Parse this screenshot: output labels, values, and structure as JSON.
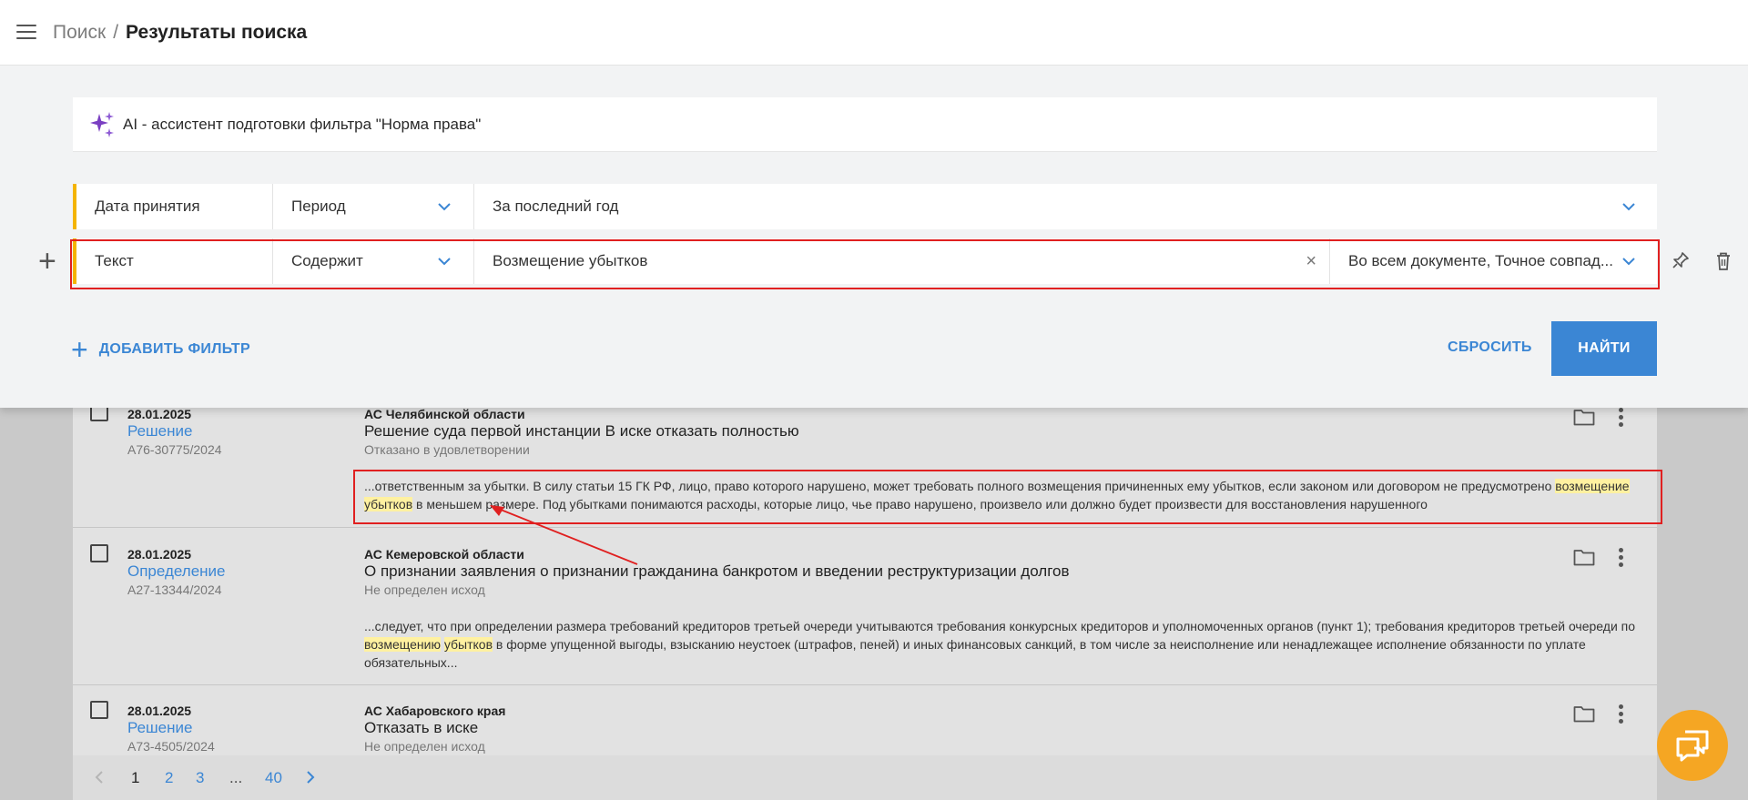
{
  "breadcrumb": {
    "link": "Поиск",
    "separator": "/",
    "current": "Результаты поиска"
  },
  "ai_assistant": {
    "label": "AI - ассистент подготовки фильтра \"Норма права\""
  },
  "filters": [
    {
      "field": "Дата принятия",
      "operator": "Период",
      "value": "За последний год"
    },
    {
      "field": "Текст",
      "operator": "Содержит",
      "value": "Возмещение убытков",
      "scope": "Во всем документе, Точное совпад..."
    }
  ],
  "actions": {
    "add_filter": "ДОБАВИТЬ ФИЛЬТР",
    "reset": "СБРОСИТЬ",
    "find": "НАЙТИ"
  },
  "results": [
    {
      "date": "28.01.2025",
      "doc_type": "Решение",
      "case": "А76-30775/2024",
      "court": "АС Челябинской области",
      "title": "Решение суда первой инстанции В иске отказать полностью",
      "outcome": "Отказано в удовлетворении",
      "snippet_a": "...ответственным за убытки. В силу статьи 15 ГК РФ, лицо, право которого нарушено, может требовать полного возмещения причиненных ему убытков, если законом или договором не предусмотрено",
      "snippet_hl1": "возмещение",
      "snippet_hl2": "убытков",
      "snippet_b": "в меньшем размере. Под убытками понимаются расходы, которые лицо, чье право нарушено, произвело или должно будет произвести для восстановления нарушенного"
    },
    {
      "date": "28.01.2025",
      "doc_type": "Определение",
      "case": "А27-13344/2024",
      "court": "АС Кемеровской области",
      "title": "О признании заявления о признании гражданина банкротом и введении реструктуризации долгов",
      "outcome": "Не определен исход",
      "snippet_a": "...следует, что при определении размера требований кредиторов третьей очереди учитываются требования конкурсных кредиторов и уполномоченных органов (пункт 1); требования кредиторов третьей очереди по",
      "snippet_hl1": "возмещению",
      "snippet_hl2": "убытков",
      "snippet_b": "в форме упущенной выгоды, взысканию неустоек (штрафов, пеней) и иных финансовых санкций, в том числе за неисполнение или ненадлежащее исполнение обязанности по уплате обязательных..."
    },
    {
      "date": "28.01.2025",
      "doc_type": "Решение",
      "case": "А73-4505/2024",
      "court": "АС Хабаровского края",
      "title": "Отказать в иске",
      "outcome": "Не определен исход"
    }
  ],
  "pagination": {
    "pages": [
      "1",
      "2",
      "3"
    ],
    "ellipsis": "...",
    "last": "40",
    "current": "1"
  },
  "colors": {
    "accent": "#3b86d4",
    "filter_marker": "#f4b400",
    "highlight": "#fff1a0",
    "annotation": "#e02020",
    "chat_button": "#f5a623"
  }
}
